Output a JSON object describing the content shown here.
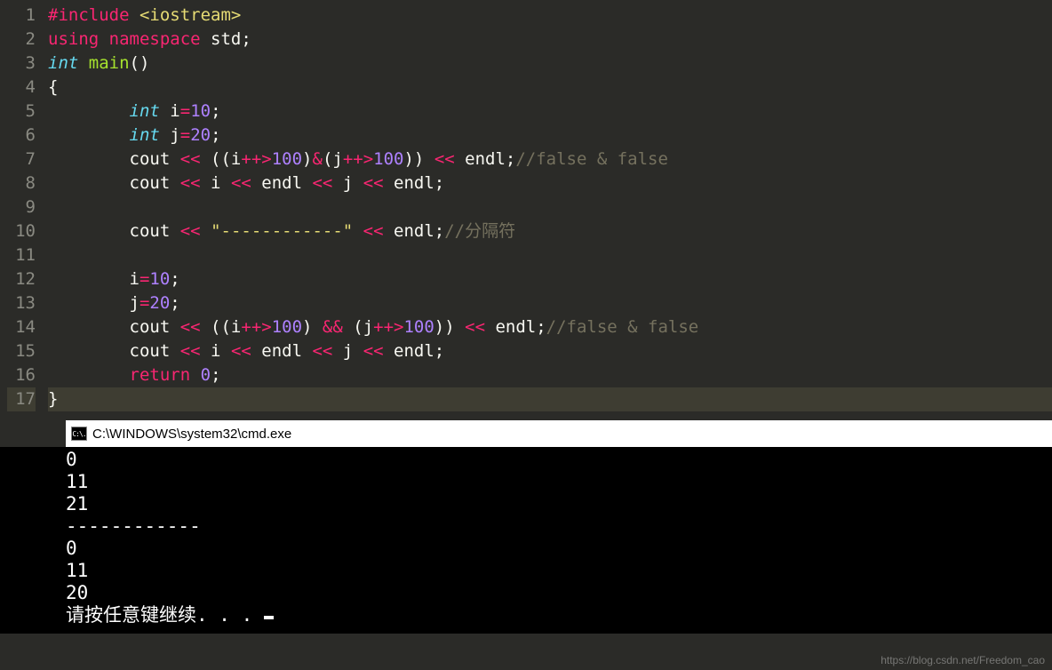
{
  "editor": {
    "line_numbers": [
      "1",
      "2",
      "3",
      "4",
      "5",
      "6",
      "7",
      "8",
      "9",
      "10",
      "11",
      "12",
      "13",
      "14",
      "15",
      "16",
      "17"
    ],
    "lines": [
      [
        {
          "cls": "kw-red",
          "t": "#include"
        },
        {
          "cls": "white",
          "t": " "
        },
        {
          "cls": "str",
          "t": "<iostream>"
        }
      ],
      [
        {
          "cls": "kw-red",
          "t": "using"
        },
        {
          "cls": "white",
          "t": " "
        },
        {
          "cls": "kw-red",
          "t": "namespace"
        },
        {
          "cls": "white",
          "t": " std;"
        }
      ],
      [
        {
          "cls": "kw-italic",
          "t": "int"
        },
        {
          "cls": "white",
          "t": " "
        },
        {
          "cls": "func",
          "t": "main"
        },
        {
          "cls": "white",
          "t": "()"
        }
      ],
      [
        {
          "cls": "white",
          "t": "{"
        }
      ],
      [
        {
          "cls": "white",
          "t": "        "
        },
        {
          "cls": "kw-italic",
          "t": "int"
        },
        {
          "cls": "white",
          "t": " i"
        },
        {
          "cls": "op",
          "t": "="
        },
        {
          "cls": "num",
          "t": "10"
        },
        {
          "cls": "white",
          "t": ";"
        }
      ],
      [
        {
          "cls": "white",
          "t": "        "
        },
        {
          "cls": "kw-italic",
          "t": "int"
        },
        {
          "cls": "white",
          "t": " j"
        },
        {
          "cls": "op",
          "t": "="
        },
        {
          "cls": "num",
          "t": "20"
        },
        {
          "cls": "white",
          "t": ";"
        }
      ],
      [
        {
          "cls": "white",
          "t": "        cout "
        },
        {
          "cls": "op",
          "t": "<<"
        },
        {
          "cls": "white",
          "t": " ((i"
        },
        {
          "cls": "op",
          "t": "++>"
        },
        {
          "cls": "num",
          "t": "100"
        },
        {
          "cls": "white",
          "t": ")"
        },
        {
          "cls": "op",
          "t": "&"
        },
        {
          "cls": "white",
          "t": "(j"
        },
        {
          "cls": "op",
          "t": "++>"
        },
        {
          "cls": "num",
          "t": "100"
        },
        {
          "cls": "white",
          "t": ")) "
        },
        {
          "cls": "op",
          "t": "<<"
        },
        {
          "cls": "white",
          "t": " endl;"
        },
        {
          "cls": "comment",
          "t": "//false & false"
        }
      ],
      [
        {
          "cls": "white",
          "t": "        cout "
        },
        {
          "cls": "op",
          "t": "<<"
        },
        {
          "cls": "white",
          "t": " i "
        },
        {
          "cls": "op",
          "t": "<<"
        },
        {
          "cls": "white",
          "t": " endl "
        },
        {
          "cls": "op",
          "t": "<<"
        },
        {
          "cls": "white",
          "t": " j "
        },
        {
          "cls": "op",
          "t": "<<"
        },
        {
          "cls": "white",
          "t": " endl;"
        }
      ],
      [
        {
          "cls": "white",
          "t": ""
        }
      ],
      [
        {
          "cls": "white",
          "t": "        cout "
        },
        {
          "cls": "op",
          "t": "<<"
        },
        {
          "cls": "white",
          "t": " "
        },
        {
          "cls": "str",
          "t": "\"------------\""
        },
        {
          "cls": "white",
          "t": " "
        },
        {
          "cls": "op",
          "t": "<<"
        },
        {
          "cls": "white",
          "t": " endl;"
        },
        {
          "cls": "comment",
          "t": "//分隔符"
        }
      ],
      [
        {
          "cls": "white",
          "t": ""
        }
      ],
      [
        {
          "cls": "white",
          "t": "        i"
        },
        {
          "cls": "op",
          "t": "="
        },
        {
          "cls": "num",
          "t": "10"
        },
        {
          "cls": "white",
          "t": ";"
        }
      ],
      [
        {
          "cls": "white",
          "t": "        j"
        },
        {
          "cls": "op",
          "t": "="
        },
        {
          "cls": "num",
          "t": "20"
        },
        {
          "cls": "white",
          "t": ";"
        }
      ],
      [
        {
          "cls": "white",
          "t": "        cout "
        },
        {
          "cls": "op",
          "t": "<<"
        },
        {
          "cls": "white",
          "t": " ((i"
        },
        {
          "cls": "op",
          "t": "++>"
        },
        {
          "cls": "num",
          "t": "100"
        },
        {
          "cls": "white",
          "t": ") "
        },
        {
          "cls": "op",
          "t": "&&"
        },
        {
          "cls": "white",
          "t": " (j"
        },
        {
          "cls": "op",
          "t": "++>"
        },
        {
          "cls": "num",
          "t": "100"
        },
        {
          "cls": "white",
          "t": ")) "
        },
        {
          "cls": "op",
          "t": "<<"
        },
        {
          "cls": "white",
          "t": " endl;"
        },
        {
          "cls": "comment",
          "t": "//false & false"
        }
      ],
      [
        {
          "cls": "white",
          "t": "        cout "
        },
        {
          "cls": "op",
          "t": "<<"
        },
        {
          "cls": "white",
          "t": " i "
        },
        {
          "cls": "op",
          "t": "<<"
        },
        {
          "cls": "white",
          "t": " endl "
        },
        {
          "cls": "op",
          "t": "<<"
        },
        {
          "cls": "white",
          "t": " j "
        },
        {
          "cls": "op",
          "t": "<<"
        },
        {
          "cls": "white",
          "t": " endl;"
        }
      ],
      [
        {
          "cls": "white",
          "t": "        "
        },
        {
          "cls": "kw-red",
          "t": "return"
        },
        {
          "cls": "white",
          "t": " "
        },
        {
          "cls": "num",
          "t": "0"
        },
        {
          "cls": "white",
          "t": ";"
        }
      ],
      [
        {
          "cls": "white",
          "t": "}"
        }
      ]
    ],
    "current_line_index": 16
  },
  "terminal": {
    "title": "C:\\WINDOWS\\system32\\cmd.exe",
    "icon_text": "C:\\.",
    "output": "0\n11\n21\n------------\n0\n11\n20\n请按任意键继续. . . "
  },
  "watermark": "https://blog.csdn.net/Freedom_cao"
}
